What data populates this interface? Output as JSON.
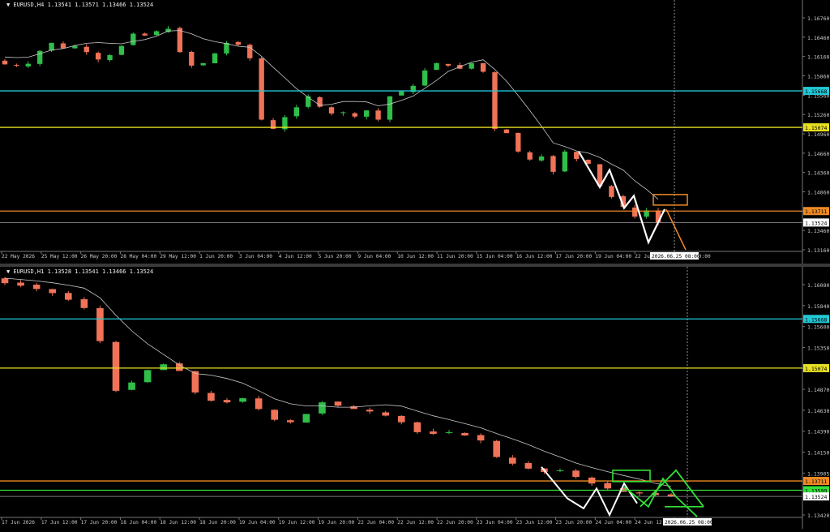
{
  "colors": {
    "background": "#000000",
    "bull": "#2fbf4a",
    "bear": "#f07358",
    "ma": "#c8c8c8",
    "cyan": "#22c8d6",
    "yellow": "#e8e022",
    "orange": "#f08a24",
    "green": "#33e03a",
    "white": "#ffffff",
    "axis_text": "#c8c8c8",
    "price_line": "#9a9a9a"
  },
  "chart_data": [
    {
      "type": "candlestick",
      "symbol_info": "EURUSD,H4  1.13541 1.13571 1.13466 1.13524",
      "y_ticks": [
        "1.16760",
        "1.16460",
        "1.16160",
        "1.15860",
        "1.15560",
        "1.15260",
        "1.14960",
        "1.14660",
        "1.14360",
        "1.14060",
        "1.13760",
        "1.13460",
        "1.13160"
      ],
      "ylim": [
        1.1308,
        1.1699
      ],
      "x_labels": [
        "22 May 2026",
        "25 May 12:00",
        "26 May 20:00",
        "28 May 04:00",
        "29 May 12:00",
        "1 Jun 20:00",
        "3 Jun 04:00",
        "4 Jun 12:00",
        "5 Jun 20:00",
        "9 Jun 04:00",
        "10 Jun 12:00",
        "11 Jun 20:00",
        "15 Jun 04:00",
        "16 Jun 12:00",
        "17 Jun 20:00",
        "19 Jun 04:00",
        "22 Jun 12:00",
        "23 Jun 20:00"
      ],
      "cursor_label": "2026.06.25 08:00",
      "levels": [
        {
          "name": "cyan",
          "price": 1.15668,
          "label": "1.15668"
        },
        {
          "name": "yellow",
          "price": 1.15074,
          "label": "1.15074"
        },
        {
          "name": "orange",
          "price": 1.13711,
          "label": "1.13711"
        }
      ],
      "current_price": {
        "price": 1.13524,
        "label": "1.13524"
      },
      "close_path": [
        1.161,
        1.1608,
        1.1611,
        1.1632,
        1.1645,
        1.1636,
        1.164,
        1.163,
        1.1618,
        1.1625,
        1.164,
        1.166,
        1.1657,
        1.1664,
        1.1668,
        1.163,
        1.1608,
        1.1612,
        1.1628,
        1.1645,
        1.1642,
        1.162,
        1.152,
        1.1505,
        1.1524,
        1.154,
        1.1558,
        1.1541,
        1.153,
        1.1532,
        1.1525,
        1.1535,
        1.152,
        1.1558,
        1.1566,
        1.1575,
        1.16,
        1.1612,
        1.1608,
        1.1603,
        1.1612,
        1.1598,
        1.1505,
        1.1498,
        1.1468,
        1.1455,
        1.146,
        1.1435,
        1.1468,
        1.1456,
        1.1448,
        1.1412,
        1.1394,
        1.1378,
        1.1362,
        1.1372,
        1.1352
      ]
    },
    {
      "type": "candlestick",
      "symbol_info": "EURUSD,H1  1.13528 1.13541 1.13466 1.13524",
      "y_ticks": [
        "1.16080",
        "1.15840",
        "1.15600",
        "1.15350",
        "1.15110",
        "1.14870",
        "1.14630",
        "1.14390",
        "1.14150",
        "1.13905",
        "1.13660",
        "1.13420"
      ],
      "ylim": [
        1.133,
        1.1618
      ],
      "x_labels": [
        "17 Jun 2026",
        "17 Jun 12:00",
        "17 Jun 20:00",
        "18 Jun 04:00",
        "18 Jun 12:00",
        "18 Jun 20:00",
        "19 Jun 04:00",
        "19 Jun 12:00",
        "19 Jun 20:00",
        "22 Jun 04:00",
        "22 Jun 12:00",
        "22 Jun 20:00",
        "23 Jun 04:00",
        "23 Jun 12:00",
        "23 Jun 20:00",
        "24 Jun 04:00",
        "24 Jun 12:00",
        "24 Jun 20:00"
      ],
      "cursor_label": "2026.06.25 08:00",
      "levels": [
        {
          "name": "cyan",
          "price": 1.15668,
          "label": "1.15668"
        },
        {
          "name": "yellow",
          "price": 1.15074,
          "label": "1.15074"
        },
        {
          "name": "orange",
          "price": 1.13711,
          "label": "1.13711"
        },
        {
          "name": "green",
          "price": 1.13599,
          "label": "1.13599"
        }
      ],
      "current_price": {
        "price": 1.13524,
        "label": "1.13524"
      },
      "close_path": [
        1.161,
        1.1607,
        1.1603,
        1.1598,
        1.159,
        1.158,
        1.154,
        1.148,
        1.149,
        1.1505,
        1.1512,
        1.1504,
        1.1478,
        1.1468,
        1.1466,
        1.1471,
        1.1458,
        1.1445,
        1.1442,
        1.1452,
        1.1466,
        1.1462,
        1.1458,
        1.1455,
        1.145,
        1.1442,
        1.143,
        1.1428,
        1.143,
        1.1426,
        1.142,
        1.14,
        1.1392,
        1.1386,
        1.1382,
        1.1384,
        1.1376,
        1.1368,
        1.1362,
        1.1358,
        1.1356,
        1.1354,
        1.1352
      ]
    }
  ]
}
